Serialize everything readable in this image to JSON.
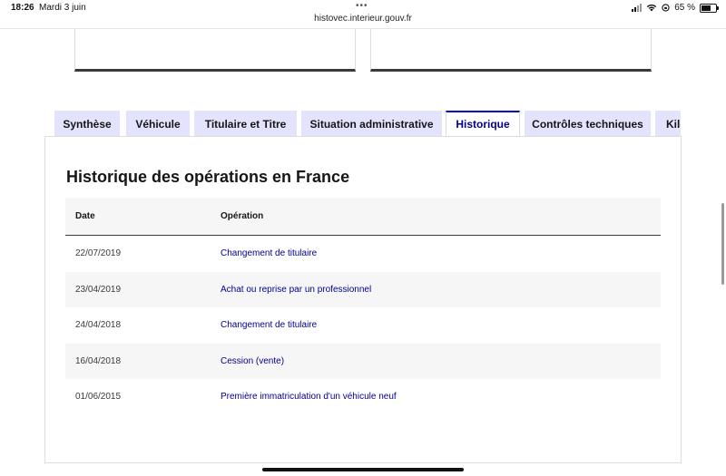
{
  "status_bar": {
    "time": "18:26",
    "date": "Mardi 3 juin",
    "url": "histovec.interieur.gouv.fr",
    "battery": "65 %",
    "battery_level": 0.65
  },
  "tabs": [
    {
      "label": "Synthèse",
      "active": false
    },
    {
      "label": "Véhicule",
      "active": false
    },
    {
      "label": "Titulaire et Titre",
      "active": false
    },
    {
      "label": "Situation administrative",
      "active": false
    },
    {
      "label": "Historique",
      "active": true
    },
    {
      "label": "Contrôles techniques",
      "active": false
    },
    {
      "label": "Kilométrage",
      "active": false
    }
  ],
  "panel": {
    "title": "Historique des opérations en France",
    "columns": {
      "date": "Date",
      "operation": "Opération"
    },
    "rows": [
      {
        "date": "22/07/2019",
        "operation": "Changement de titulaire"
      },
      {
        "date": "23/04/2019",
        "operation": "Achat ou reprise par un professionnel"
      },
      {
        "date": "24/04/2018",
        "operation": "Changement de titulaire"
      },
      {
        "date": "16/04/2018",
        "operation": "Cession (vente)"
      },
      {
        "date": "01/06/2015",
        "operation": "Première immatriculation d'un véhicule neuf"
      }
    ]
  },
  "colors": {
    "accent": "#000091",
    "tab_bg": "#e3e3fd",
    "row_alt": "#f6f6f6"
  }
}
